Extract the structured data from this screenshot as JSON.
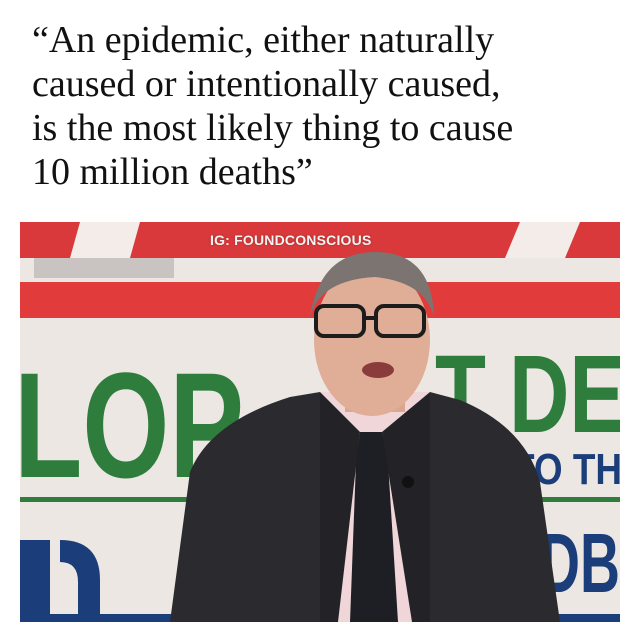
{
  "quote": {
    "lines": [
      "“An epidemic, either naturally",
      "caused or intentionally caused,",
      "is the most likely thing to cause",
      "10 million deaths”"
    ]
  },
  "photo": {
    "watermark": "IG: FOUNDCONSCIOUS",
    "backdrop": {
      "large_left": "LOP",
      "large_right": "T DE",
      "small_right": "TO TH",
      "bottom_right": "NDB"
    }
  },
  "colors": {
    "backdrop_red": "#d9393a",
    "backdrop_green": "#2e7d3d",
    "backdrop_blue": "#1b3d7a",
    "suit": "#2b2b2f",
    "shirt": "#f0d6d8",
    "tie": "#1d1f24"
  }
}
